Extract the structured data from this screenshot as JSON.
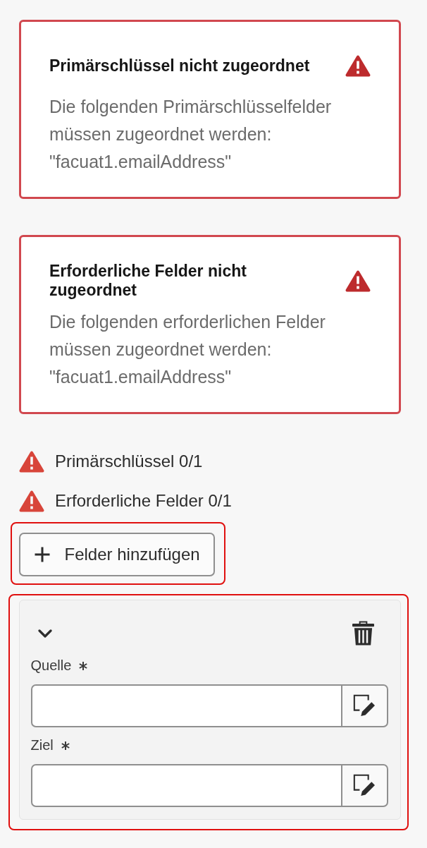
{
  "alerts": [
    {
      "title": "Primärschlüssel nicht zugeordnet",
      "message": "Die folgenden Primärschlüsselfelder müssen zugeordnet werden: \"facuat1.emailAddress\""
    },
    {
      "title": "Erforderliche Felder nicht zugeordnet",
      "message": "Die folgenden erforderlichen Felder müssen zugeordnet werden: \"facuat1.emailAddress\""
    }
  ],
  "checks": [
    {
      "label": "Primärschlüssel 0/1"
    },
    {
      "label": "Erforderliche Felder 0/1"
    }
  ],
  "add_button": {
    "label": "Felder hinzufügen",
    "highlighted": true
  },
  "mapping": {
    "highlighted": true,
    "expanded": true,
    "fields": [
      {
        "label": "Quelle",
        "required": true
      },
      {
        "label": "Ziel",
        "required": true
      }
    ]
  }
}
